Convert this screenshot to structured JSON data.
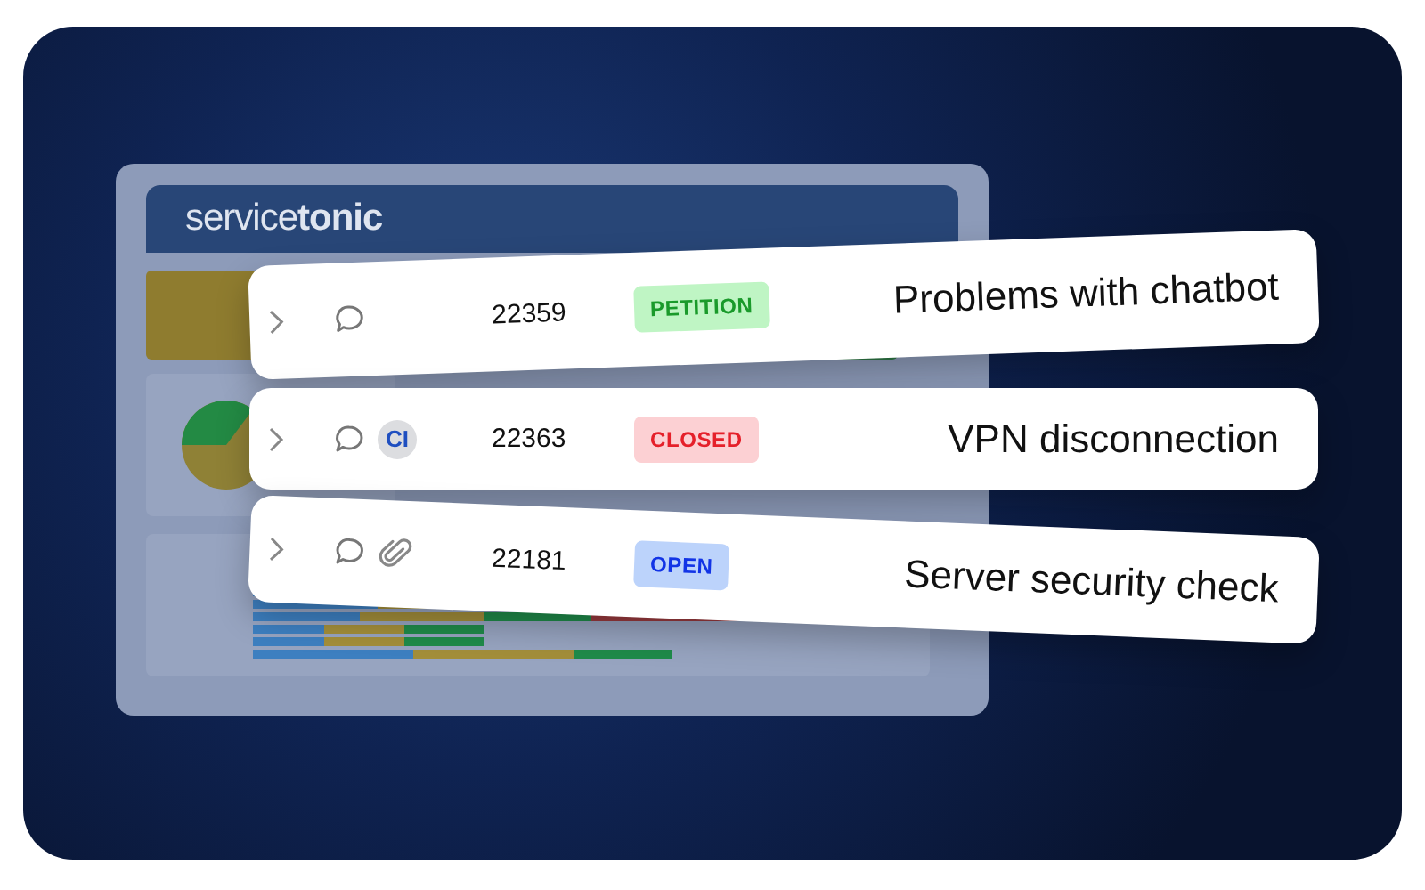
{
  "dashboard": {
    "logo": {
      "light": "service",
      "bold": "tonic"
    },
    "kind": "picture"
  },
  "tickets": [
    {
      "id": "22359",
      "status": {
        "label": "PETITION",
        "kind": "petition"
      },
      "title": "Problems with chatbot",
      "icons": [
        {
          "kind": "comment"
        }
      ]
    },
    {
      "id": "22363",
      "status": {
        "label": "CLOSED",
        "kind": "closed"
      },
      "title": "VPN disconnection",
      "icons": [
        {
          "kind": "comment"
        },
        {
          "kind": "avatar",
          "text": "CI"
        }
      ]
    },
    {
      "id": "22181",
      "status": {
        "label": "OPEN",
        "kind": "open"
      },
      "title": "Server security check",
      "icons": [
        {
          "kind": "comment"
        },
        {
          "kind": "attachment"
        }
      ]
    }
  ]
}
